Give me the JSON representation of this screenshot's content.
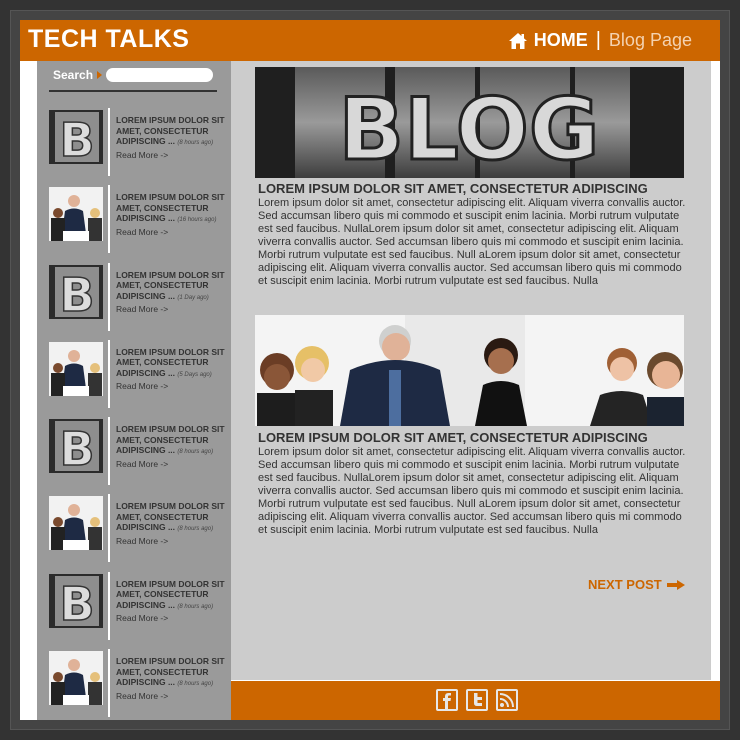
{
  "header": {
    "brand": "TECH TALKS",
    "nav": {
      "home": "HOME",
      "separator": "|",
      "current": "Blog Page"
    }
  },
  "sidebar": {
    "search_label": "Search",
    "posts": [
      {
        "thumb": "blog",
        "title": "LOREM IPSUM DOLOR SIT AMET, CONSECTETUR ADIPISCING ...",
        "time": "(8 hours ago)",
        "more": "Read More ->"
      },
      {
        "thumb": "team",
        "title": "LOREM IPSUM DOLOR SIT AMET, CONSECTETUR ADIPISCING ...",
        "time": "(16 hours ago)",
        "more": "Read More ->"
      },
      {
        "thumb": "blog",
        "title": "LOREM IPSUM DOLOR SIT AMET, CONSECTETUR ADIPISCING ...",
        "time": "(1 Day ago)",
        "more": "Read More ->"
      },
      {
        "thumb": "team",
        "title": "LOREM IPSUM DOLOR SIT AMET, CONSECTETUR ADIPISCING ...",
        "time": "(5 Days ago)",
        "more": "Read More ->"
      },
      {
        "thumb": "blog",
        "title": "LOREM IPSUM DOLOR SIT AMET, CONSECTETUR ADIPISCING ...",
        "time": "(8 hours ago)",
        "more": "Read More ->"
      },
      {
        "thumb": "team",
        "title": "LOREM IPSUM DOLOR SIT AMET, CONSECTETUR ADIPISCING ...",
        "time": "(8 hours ago)",
        "more": "Read More ->"
      },
      {
        "thumb": "blog",
        "title": "LOREM IPSUM DOLOR SIT AMET, CONSECTETUR ADIPISCING ...",
        "time": "(8 hours ago)",
        "more": "Read More ->"
      },
      {
        "thumb": "team",
        "title": "LOREM IPSUM DOLOR SIT AMET, CONSECTETUR ADIPISCING ...",
        "time": "(8 hours ago)",
        "more": "Read More ->"
      }
    ]
  },
  "articles": [
    {
      "image_text": "BLOG",
      "title": "LOREM IPSUM DOLOR SIT AMET, CONSECTETUR ADIPISCING",
      "body": "Lorem ipsum dolor sit amet, consectetur adipiscing elit. Aliquam viverra convallis auctor. Sed accumsan libero quis mi commodo et suscipit enim lacinia. Morbi rutrum vulputate est sed faucibus. NullaLorem ipsum dolor sit amet, consectetur adipiscing elit. Aliquam viverra convallis auctor. Sed accumsan libero quis mi commodo et suscipit enim lacinia. Morbi rutrum vulputate est sed faucibus. Null aLorem ipsum dolor sit amet, consectetur adipiscing elit. Aliquam viverra convallis auctor. Sed accumsan libero quis mi commodo et suscipit enim lacinia. Morbi rutrum vulputate est sed faucibus. Nulla"
    },
    {
      "title": "LOREM IPSUM DOLOR SIT AMET, CONSECTETUR ADIPISCING",
      "body": "Lorem ipsum dolor sit amet, consectetur adipiscing elit. Aliquam viverra convallis auctor. Sed accumsan libero quis mi commodo et suscipit enim lacinia. Morbi rutrum vulputate est sed faucibus. NullaLorem ipsum dolor sit amet, consectetur adipiscing elit. Aliquam viverra convallis auctor. Sed accumsan libero quis mi commodo et suscipit enim lacinia. Morbi rutrum vulputate est sed faucibus. Null aLorem ipsum dolor sit amet, consectetur adipiscing elit. Aliquam viverra convallis auctor. Sed accumsan libero quis mi commodo et suscipit enim lacinia. Morbi rutrum vulputate est sed faucibus. Nulla"
    }
  ],
  "next_post": "NEXT POST",
  "footer": {
    "social": [
      "facebook-icon",
      "twitter-icon",
      "rss-icon"
    ]
  },
  "colors": {
    "accent": "#cc6600",
    "sidebar": "#9a9a9a",
    "content": "#cccccc",
    "frame": "#333333"
  }
}
